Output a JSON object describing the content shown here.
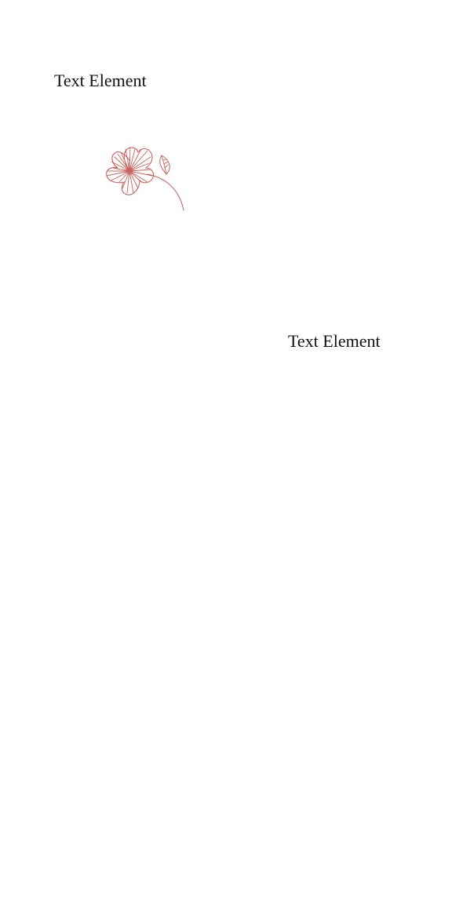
{
  "elements": {
    "text_top": "Text Element",
    "text_mid": "Text Element"
  },
  "decoration": {
    "icon": "flower-illustration-icon",
    "color": "#c8625e"
  }
}
